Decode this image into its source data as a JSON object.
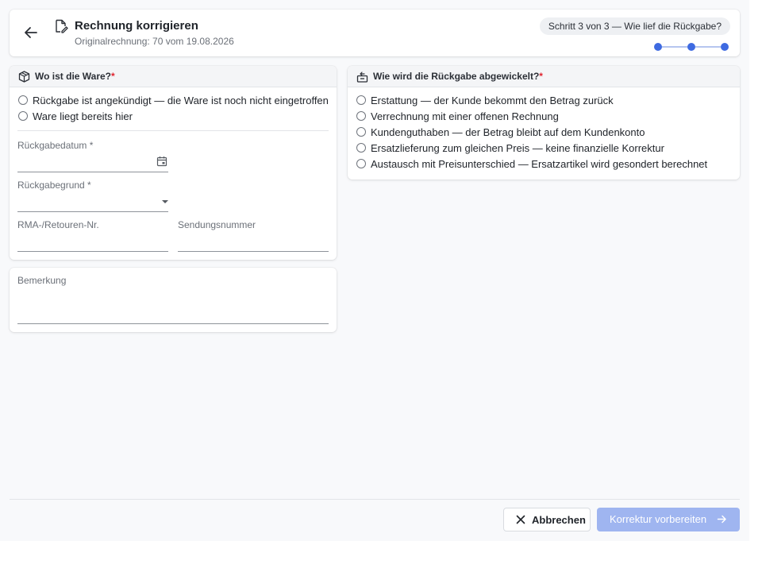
{
  "header": {
    "title": "Rechnung korrigieren",
    "subtitle": "Originalrechnung: 70 vom 19.08.2026",
    "step_pill": "Schritt 3 von 3 — Wie lief die Rückgabe?",
    "back_icon": "arrow-left-icon",
    "doc_icon": "document-edit-icon",
    "steps_total": 3,
    "step_current": 3
  },
  "left_card": {
    "heading": "Wo ist die Ware?",
    "required_mark": "*",
    "icon": "package-icon",
    "options": [
      {
        "label": "Rückgabe ist angekündigt — die Ware ist noch nicht eingetroffen",
        "checked": false
      },
      {
        "label": "Ware liegt bereits hier",
        "checked": false
      }
    ],
    "fields": {
      "return_date": {
        "label": "Rückgabedatum *",
        "value": ""
      },
      "return_reason": {
        "label": "Rückgabegrund *",
        "value": ""
      },
      "rma_number": {
        "label": "RMA-/Retouren-Nr.",
        "value": ""
      },
      "tracking_number": {
        "label": "Sendungsnummer",
        "value": ""
      }
    }
  },
  "right_card": {
    "heading": "Wie wird die Rückgabe abgewickelt?",
    "required_mark": "*",
    "icon": "return-box-icon",
    "options": [
      {
        "label": "Erstattung — der Kunde bekommt den Betrag zurück",
        "checked": false
      },
      {
        "label": "Verrechnung mit einer offenen Rechnung",
        "checked": false
      },
      {
        "label": "Kundenguthaben — der Betrag bleibt auf dem Kundenkonto",
        "checked": false
      },
      {
        "label": "Ersatzlieferung zum gleichen Preis — keine finanzielle Korrektur",
        "checked": false
      },
      {
        "label": "Austausch mit Preisunterschied — Ersatzartikel wird gesondert berechnet",
        "checked": false
      }
    ]
  },
  "note_card": {
    "label": "Bemerkung",
    "value": ""
  },
  "footer": {
    "cancel_label": "Abbrechen",
    "primary_label": "Korrektur vorbereiten",
    "primary_enabled": false
  },
  "colors": {
    "accent": "#3e6ae1",
    "primary_disabled": "#9fb5f0",
    "required": "#e0242f",
    "background": "#f8f9fb"
  }
}
